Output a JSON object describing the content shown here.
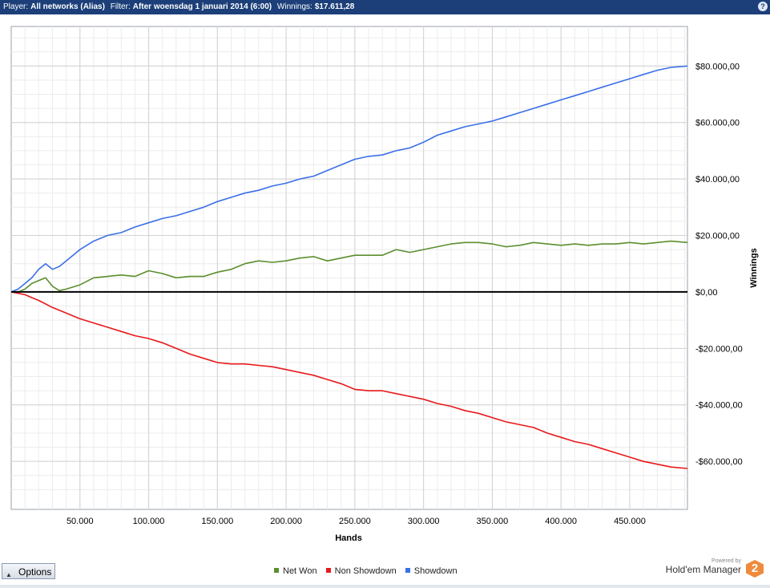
{
  "header": {
    "player_label": "Player:",
    "player_value": "All networks (Alias)",
    "filter_label": "Filter:",
    "filter_value": "After woensdag 1 januari 2014 (6:00)",
    "winnings_label": "Winnings:",
    "winnings_value": "$17.611,28",
    "help_icon": "?"
  },
  "footer": {
    "options_label": "Options",
    "options_icon": "triangle-up-icon",
    "powered_by": "Powered by",
    "brand": "Hold'em Manager",
    "logo_text": "2"
  },
  "chart_data": {
    "type": "line",
    "xlabel": "Hands",
    "ylabel": "Winnings",
    "xlim": [
      0,
      492000
    ],
    "ylim": [
      -77000,
      94000
    ],
    "x_ticks": [
      50000,
      100000,
      150000,
      200000,
      250000,
      300000,
      350000,
      400000,
      450000
    ],
    "x_tick_labels": [
      "50.000",
      "100.000",
      "150.000",
      "200.000",
      "250.000",
      "300.000",
      "350.000",
      "400.000",
      "450.000"
    ],
    "y_ticks": [
      80000,
      60000,
      40000,
      20000,
      0,
      -20000,
      -40000,
      -60000
    ],
    "y_tick_labels": [
      "$80.000,00",
      "$60.000,00",
      "$40.000,00",
      "$20.000,00",
      "$0,00",
      "-$20.000,00",
      "-$40.000,00",
      "-$60.000,00"
    ],
    "grid": true,
    "legend_position": "bottom",
    "series": [
      {
        "name": "Net Won",
        "color": "#5b8f2e",
        "x": [
          0,
          5000,
          10000,
          15000,
          20000,
          25000,
          30000,
          35000,
          40000,
          50000,
          60000,
          70000,
          80000,
          90000,
          100000,
          110000,
          120000,
          130000,
          140000,
          150000,
          160000,
          170000,
          180000,
          190000,
          200000,
          210000,
          220000,
          230000,
          240000,
          250000,
          260000,
          270000,
          280000,
          290000,
          300000,
          310000,
          320000,
          330000,
          340000,
          350000,
          360000,
          370000,
          380000,
          390000,
          400000,
          410000,
          420000,
          430000,
          440000,
          450000,
          460000,
          470000,
          480000,
          492000
        ],
        "values": [
          0,
          0,
          1000,
          3000,
          4000,
          5000,
          2000,
          500,
          1000,
          2500,
          5000,
          5500,
          6000,
          5500,
          7500,
          6500,
          5000,
          5500,
          5500,
          7000,
          8000,
          10000,
          11000,
          10500,
          11000,
          12000,
          12500,
          11000,
          12000,
          13000,
          13000,
          13000,
          15000,
          14000,
          15000,
          16000,
          17000,
          17500,
          17500,
          17000,
          16000,
          16500,
          17500,
          17000,
          16500,
          17000,
          16500,
          17000,
          17000,
          17500,
          17000,
          17500,
          18000,
          17500
        ]
      },
      {
        "name": "Non Showdown",
        "color": "#e8191b",
        "x": [
          0,
          5000,
          10000,
          15000,
          20000,
          30000,
          40000,
          50000,
          60000,
          70000,
          80000,
          90000,
          100000,
          110000,
          120000,
          130000,
          140000,
          150000,
          160000,
          170000,
          180000,
          190000,
          200000,
          210000,
          220000,
          230000,
          240000,
          250000,
          260000,
          270000,
          280000,
          290000,
          300000,
          310000,
          320000,
          330000,
          340000,
          350000,
          360000,
          370000,
          380000,
          390000,
          400000,
          410000,
          420000,
          430000,
          440000,
          450000,
          460000,
          470000,
          480000,
          492000
        ],
        "values": [
          0,
          -500,
          -1000,
          -2000,
          -3000,
          -5500,
          -7500,
          -9500,
          -11000,
          -12500,
          -14000,
          -15500,
          -16500,
          -18000,
          -20000,
          -22000,
          -23500,
          -25000,
          -25500,
          -25500,
          -26000,
          -26500,
          -27500,
          -28500,
          -29500,
          -31000,
          -32500,
          -34500,
          -35000,
          -35000,
          -36000,
          -37000,
          -38000,
          -39500,
          -40500,
          -42000,
          -43000,
          -44500,
          -46000,
          -47000,
          -48000,
          -50000,
          -51500,
          -53000,
          -54000,
          -55500,
          -57000,
          -58500,
          -60000,
          -61000,
          -62000,
          -62500
        ]
      },
      {
        "name": "Showdown",
        "color": "#3a6fe8",
        "x": [
          0,
          5000,
          10000,
          15000,
          20000,
          25000,
          30000,
          35000,
          40000,
          50000,
          60000,
          70000,
          80000,
          90000,
          100000,
          110000,
          120000,
          130000,
          140000,
          150000,
          160000,
          170000,
          180000,
          190000,
          200000,
          210000,
          220000,
          230000,
          240000,
          250000,
          260000,
          270000,
          280000,
          290000,
          300000,
          310000,
          320000,
          330000,
          340000,
          350000,
          360000,
          370000,
          380000,
          390000,
          400000,
          410000,
          420000,
          430000,
          440000,
          450000,
          460000,
          470000,
          480000,
          492000
        ],
        "values": [
          0,
          1000,
          3000,
          5000,
          8000,
          10000,
          8000,
          9000,
          11000,
          15000,
          18000,
          20000,
          21000,
          23000,
          24500,
          26000,
          27000,
          28500,
          30000,
          32000,
          33500,
          35000,
          36000,
          37500,
          38500,
          40000,
          41000,
          43000,
          45000,
          47000,
          48000,
          48500,
          50000,
          51000,
          53000,
          55500,
          57000,
          58500,
          59500,
          60500,
          62000,
          63500,
          65000,
          66500,
          68000,
          69500,
          71000,
          72500,
          74000,
          75500,
          77000,
          78500,
          79500,
          80000
        ]
      }
    ]
  }
}
